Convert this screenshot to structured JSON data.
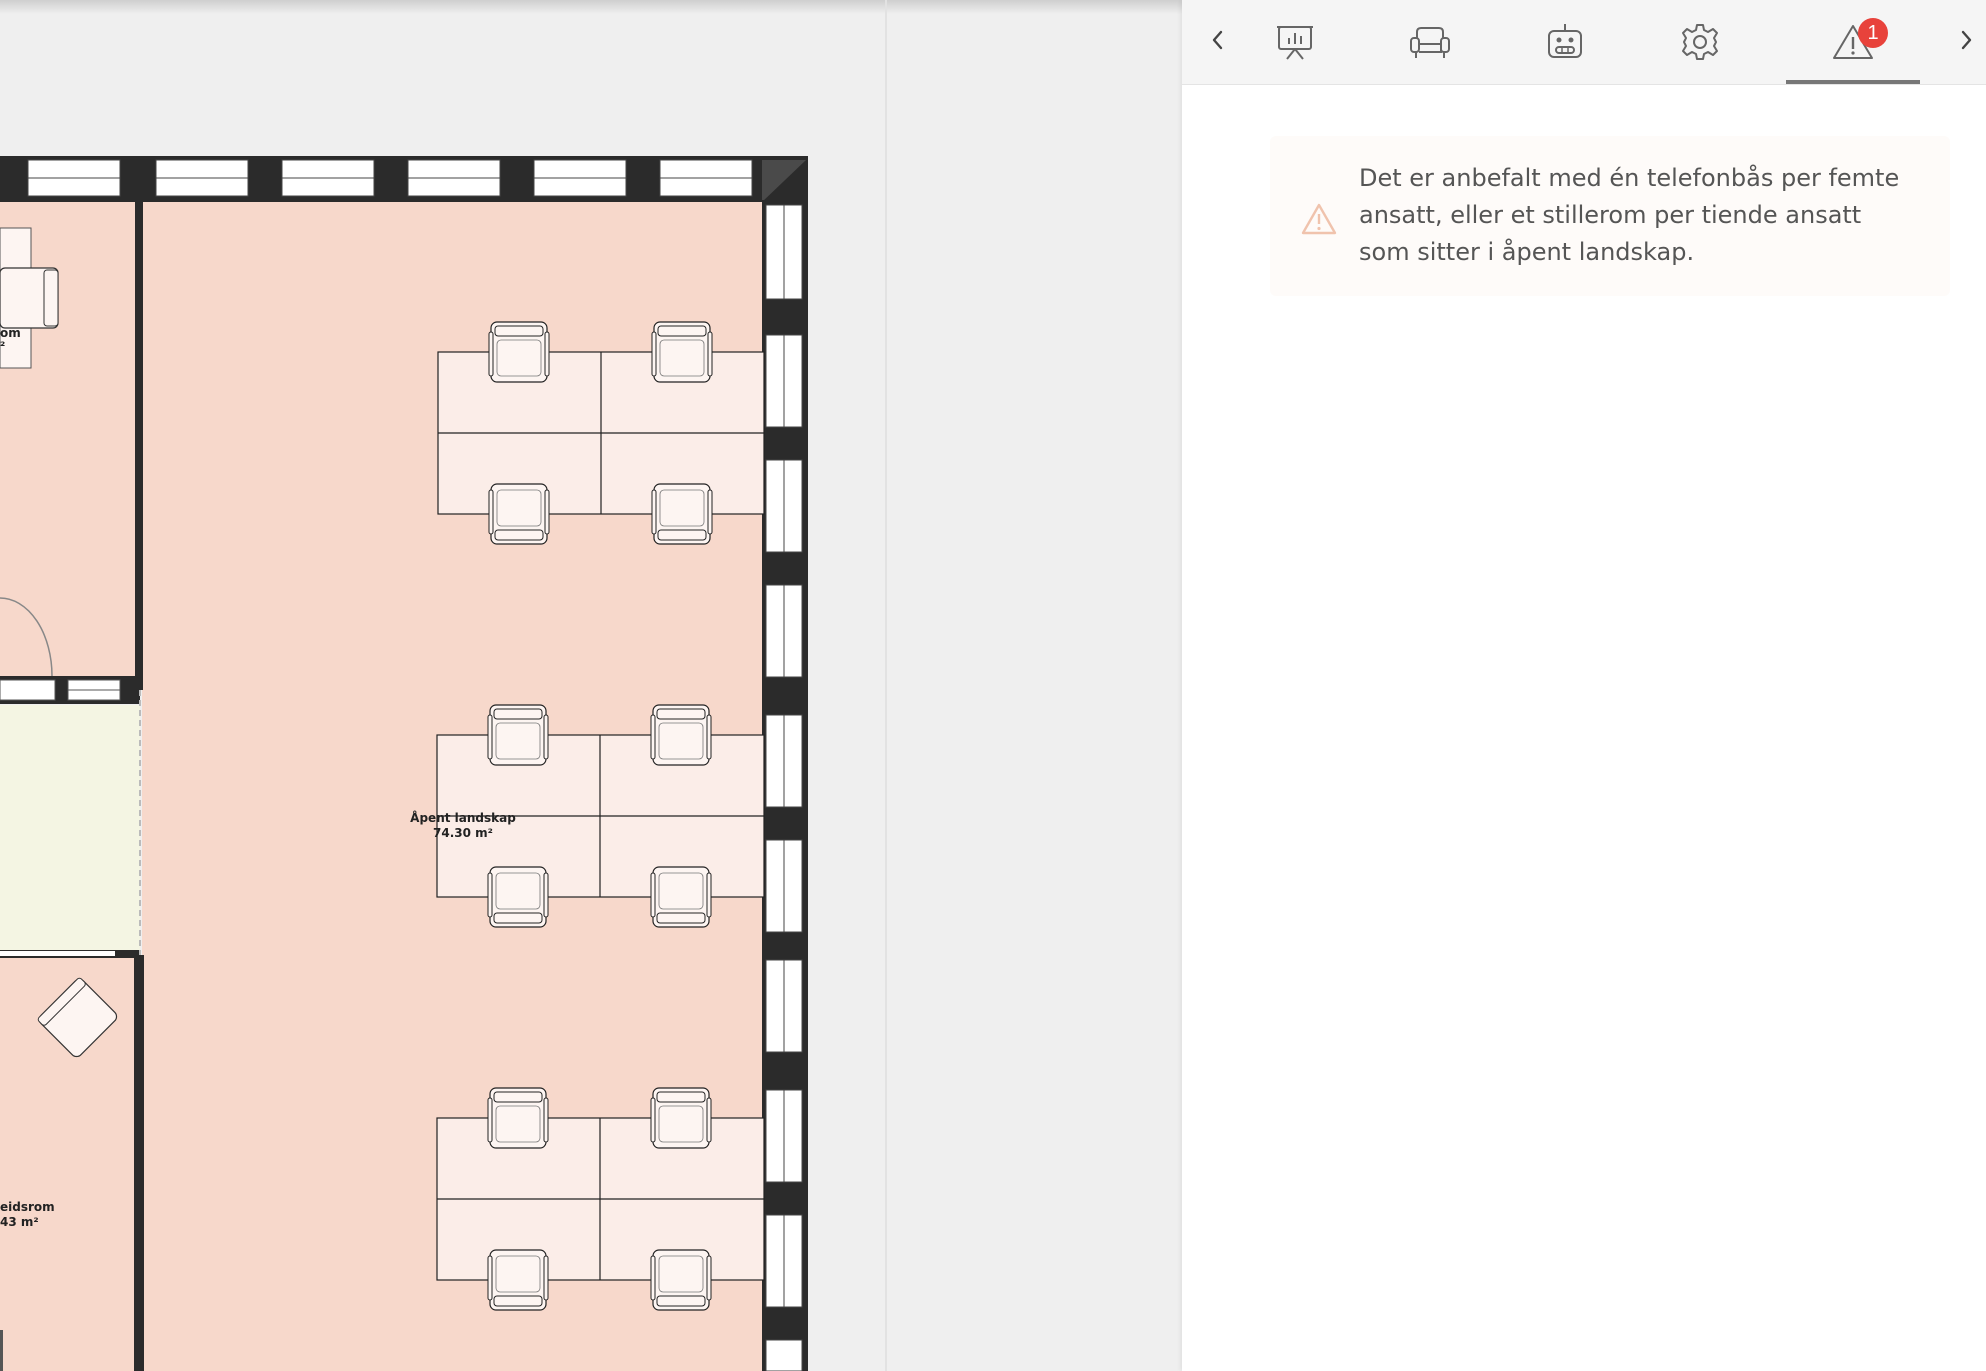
{
  "floor_plan": {
    "rooms": [
      {
        "name": "Åpent landskap",
        "area": "74.30 m²"
      },
      {
        "name": "om",
        "area": "²"
      },
      {
        "name": "eidsrom",
        "area": "43 m²"
      }
    ]
  },
  "panel": {
    "nav": {
      "prev": "previous-arrow",
      "next": "next-arrow"
    },
    "tabs": [
      {
        "icon": "presentation-icon"
      },
      {
        "icon": "armchair-icon"
      },
      {
        "icon": "robot-icon"
      },
      {
        "icon": "gear-icon"
      },
      {
        "icon": "warning-icon",
        "badge": "1",
        "active": true
      }
    ],
    "warning": {
      "text": "Det er anbefalt med én telefonbås per femte ansatt, eller et stillerom per tiende ansatt som sitter i åpent landskap."
    }
  },
  "colors": {
    "room_fill": "#f7d8cb",
    "corridor_fill": "#f4f5e3",
    "wall": "#2b2b2b",
    "badge": "#e8423b",
    "warning_icon": "#f0c3ad"
  }
}
